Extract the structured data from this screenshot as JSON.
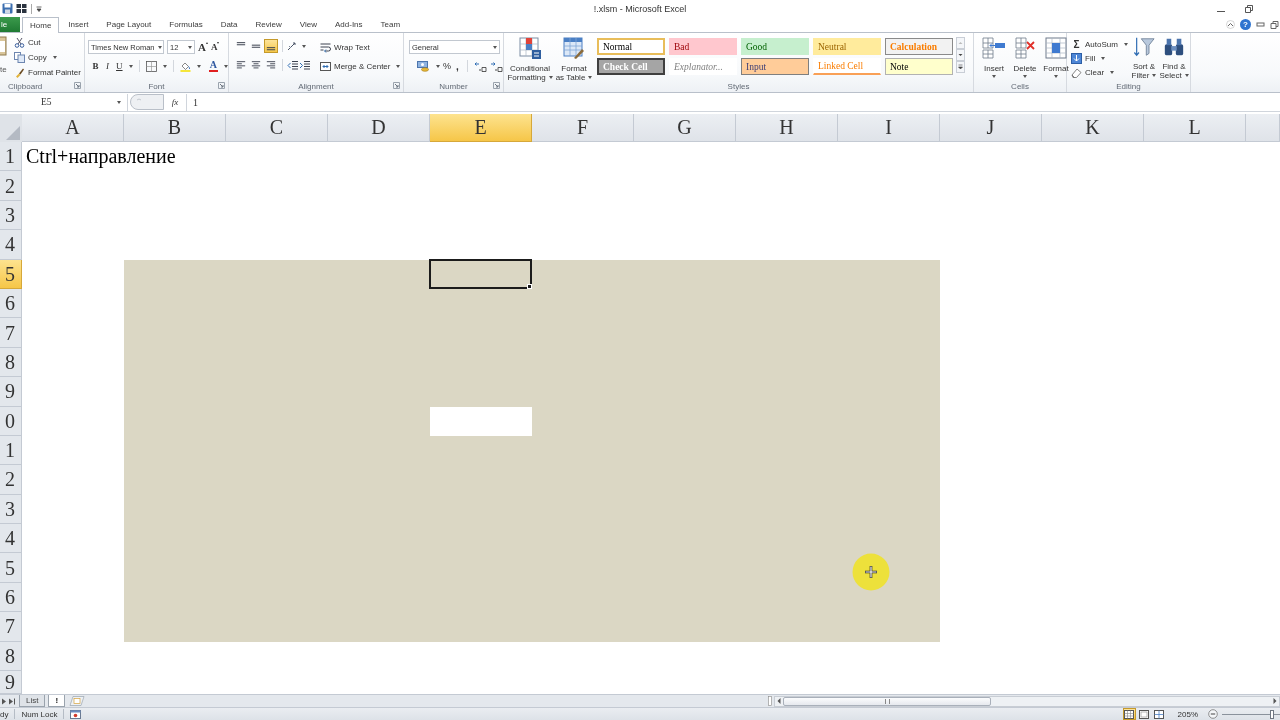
{
  "window": {
    "title": "!.xlsm - Microsoft Excel"
  },
  "tab_bar": {
    "tabs": [
      {
        "label": "le",
        "kind": "file",
        "selected": false
      },
      {
        "label": "Home",
        "kind": "tab",
        "selected": true
      },
      {
        "label": "Insert",
        "kind": "tab",
        "selected": false
      },
      {
        "label": "Page Layout",
        "kind": "tab",
        "selected": false
      },
      {
        "label": "Formulas",
        "kind": "tab",
        "selected": false
      },
      {
        "label": "Data",
        "kind": "tab",
        "selected": false
      },
      {
        "label": "Review",
        "kind": "tab",
        "selected": false
      },
      {
        "label": "View",
        "kind": "tab",
        "selected": false
      },
      {
        "label": "Add-Ins",
        "kind": "tab",
        "selected": false
      },
      {
        "label": "Team",
        "kind": "tab",
        "selected": false
      }
    ],
    "help": "?"
  },
  "ribbon": {
    "clipboard": {
      "label": "Clipboard",
      "paste_label": "te",
      "items": [
        {
          "label": "Cut",
          "kind": "cut",
          "dropdown": false
        },
        {
          "label": "Copy",
          "kind": "copy",
          "dropdown": true
        },
        {
          "label": "Format Painter",
          "kind": "painter",
          "dropdown": false
        }
      ]
    },
    "font": {
      "label": "Font",
      "font_name": "Times New Roman",
      "font_size": "12",
      "grow_label": "A",
      "shrink_label": "A",
      "format_buttons": [
        {
          "label": "B",
          "kind": "bold",
          "dropdown": false
        },
        {
          "label": "I",
          "kind": "italic",
          "dropdown": false
        },
        {
          "label": "U",
          "kind": "underline",
          "dropdown": true
        }
      ],
      "font_color_label": "A"
    },
    "alignment": {
      "label": "Alignment",
      "vertical": [
        {
          "kind": "top",
          "selected": false
        },
        {
          "kind": "middle",
          "selected": false
        },
        {
          "kind": "bottom",
          "selected": true
        }
      ],
      "horizontal": [
        {
          "kind": "left",
          "selected": false
        },
        {
          "kind": "center",
          "selected": false
        },
        {
          "kind": "right",
          "selected": false
        }
      ],
      "wrap_text": "Wrap Text",
      "merge": "Merge & Center"
    },
    "number": {
      "label": "Number",
      "format": "General",
      "percent": "%",
      "comma": ","
    },
    "styles": {
      "label": "Styles",
      "buttons": [
        {
          "kind": "conditional",
          "lines": [
            "Conditional",
            "Formatting"
          ]
        },
        {
          "kind": "table",
          "lines": [
            "Format",
            "as Table"
          ]
        }
      ],
      "gallery": [
        {
          "label": "Normal",
          "kind": "normal",
          "selected": true
        },
        {
          "label": "Bad",
          "kind": "bad",
          "selected": false
        },
        {
          "label": "Good",
          "kind": "good",
          "selected": false
        },
        {
          "label": "Neutral",
          "kind": "neutral",
          "selected": false
        },
        {
          "label": "Calculation",
          "kind": "calculation",
          "selected": false
        },
        {
          "label": "Check Cell",
          "kind": "check",
          "selected": false
        },
        {
          "label": "Explanator...",
          "kind": "explanatory",
          "selected": false
        },
        {
          "label": "Input",
          "kind": "input",
          "selected": false
        },
        {
          "label": "Linked Cell",
          "kind": "linked",
          "selected": false
        },
        {
          "label": "Note",
          "kind": "note",
          "selected": false
        }
      ]
    },
    "cells": {
      "label": "Cells",
      "buttons": [
        {
          "label": "Insert",
          "kind": "insert"
        },
        {
          "label": "Delete",
          "kind": "delete"
        },
        {
          "label": "Format",
          "kind": "format"
        }
      ]
    },
    "editing": {
      "label": "Editing",
      "items": [
        {
          "label": "AutoSum",
          "kind": "autosum",
          "symbol": "Σ"
        },
        {
          "label": "Fill",
          "kind": "fill"
        },
        {
          "label": "Clear",
          "kind": "clear"
        }
      ],
      "buttons": [
        {
          "kind": "sort",
          "lines": [
            "Sort &",
            "Filter"
          ]
        },
        {
          "kind": "find",
          "lines": [
            "Find &",
            "Select"
          ]
        }
      ]
    }
  },
  "formula_bar": {
    "name_box": "E5",
    "function_label": "fx",
    "formula": "1"
  },
  "sheet": {
    "columns": [
      {
        "label": "A",
        "selected": false
      },
      {
        "label": "B",
        "selected": false
      },
      {
        "label": "C",
        "selected": false
      },
      {
        "label": "D",
        "selected": false
      },
      {
        "label": "E",
        "selected": true
      },
      {
        "label": "F",
        "selected": false
      },
      {
        "label": "G",
        "selected": false
      },
      {
        "label": "H",
        "selected": false
      },
      {
        "label": "I",
        "selected": false
      },
      {
        "label": "J",
        "selected": false
      },
      {
        "label": "K",
        "selected": false
      },
      {
        "label": "L",
        "selected": false
      }
    ],
    "rows": [
      {
        "label": "1",
        "selected": false,
        "text": "Ctrl+направление",
        "shaded": [
          false,
          false,
          false,
          false,
          false,
          false,
          false,
          false,
          false,
          false,
          false,
          false
        ]
      },
      {
        "label": "2",
        "selected": false,
        "shaded": [
          false,
          false,
          false,
          false,
          false,
          false,
          false,
          false,
          false,
          false,
          false,
          false
        ]
      },
      {
        "label": "3",
        "selected": false,
        "shaded": [
          false,
          false,
          false,
          false,
          false,
          false,
          false,
          false,
          false,
          false,
          false,
          false
        ]
      },
      {
        "label": "4",
        "selected": false,
        "shaded": [
          false,
          false,
          false,
          false,
          false,
          false,
          false,
          false,
          false,
          false,
          false,
          false
        ]
      },
      {
        "label": "5",
        "selected": true,
        "shaded": [
          false,
          true,
          true,
          true,
          true,
          true,
          true,
          true,
          true,
          false,
          false,
          false
        ]
      },
      {
        "label": "6",
        "selected": false,
        "shaded": [
          false,
          true,
          true,
          true,
          true,
          true,
          true,
          true,
          true,
          false,
          false,
          false
        ]
      },
      {
        "label": "7",
        "selected": false,
        "shaded": [
          false,
          true,
          true,
          true,
          true,
          true,
          true,
          true,
          true,
          false,
          false,
          false
        ]
      },
      {
        "label": "8",
        "selected": false,
        "shaded": [
          false,
          true,
          true,
          true,
          true,
          true,
          true,
          true,
          true,
          false,
          false,
          false
        ]
      },
      {
        "label": "9",
        "selected": false,
        "shaded": [
          false,
          true,
          true,
          true,
          true,
          true,
          true,
          true,
          true,
          false,
          false,
          false
        ]
      },
      {
        "label": "0",
        "selected": false,
        "shaded": [
          false,
          true,
          true,
          true,
          false,
          true,
          true,
          true,
          true,
          false,
          false,
          false
        ]
      },
      {
        "label": "1",
        "selected": false,
        "shaded": [
          false,
          true,
          true,
          true,
          true,
          true,
          true,
          true,
          true,
          false,
          false,
          false
        ]
      },
      {
        "label": "2",
        "selected": false,
        "shaded": [
          false,
          true,
          true,
          true,
          true,
          true,
          true,
          true,
          true,
          false,
          false,
          false
        ]
      },
      {
        "label": "3",
        "selected": false,
        "shaded": [
          false,
          true,
          true,
          true,
          true,
          true,
          true,
          true,
          true,
          false,
          false,
          false
        ]
      },
      {
        "label": "4",
        "selected": false,
        "shaded": [
          false,
          true,
          true,
          true,
          true,
          true,
          true,
          true,
          true,
          false,
          false,
          false
        ]
      },
      {
        "label": "5",
        "selected": false,
        "shaded": [
          false,
          true,
          true,
          true,
          true,
          true,
          true,
          true,
          true,
          false,
          false,
          false
        ]
      },
      {
        "label": "6",
        "selected": false,
        "shaded": [
          false,
          true,
          true,
          true,
          true,
          true,
          true,
          true,
          true,
          false,
          false,
          false
        ]
      },
      {
        "label": "7",
        "selected": false,
        "shaded": [
          false,
          true,
          true,
          true,
          true,
          true,
          true,
          true,
          true,
          false,
          false,
          false
        ]
      },
      {
        "label": "8",
        "selected": false,
        "shaded": [
          false,
          false,
          false,
          false,
          false,
          false,
          false,
          false,
          false,
          false,
          false,
          false
        ]
      },
      {
        "label": "9",
        "selected": false,
        "shaded": [
          false,
          false,
          false,
          false,
          false,
          false,
          false,
          false,
          false,
          false,
          false,
          false
        ]
      }
    ]
  },
  "sheet_tabs": [
    {
      "label": "List",
      "selected": false
    },
    {
      "label": "!",
      "selected": true
    }
  ],
  "status_bar": {
    "mode": "dy",
    "num_lock": "Num Lock",
    "views": [
      {
        "kind": "normal",
        "selected": true
      },
      {
        "kind": "page_layout",
        "selected": false
      },
      {
        "kind": "page_break",
        "selected": false
      }
    ],
    "zoom": "205%",
    "zoom_slider": {
      "level": 0.86
    }
  }
}
